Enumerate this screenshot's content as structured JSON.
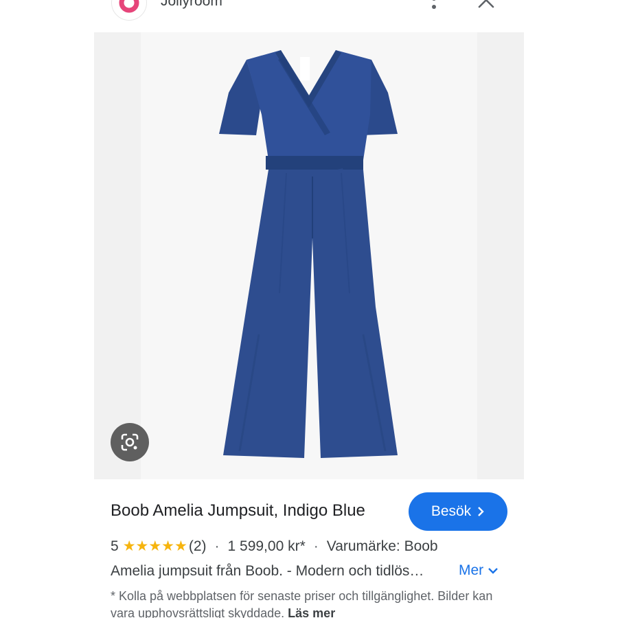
{
  "header": {
    "site_name": "Jollyroom",
    "favicon_icon": "jollyroom-logo-icon",
    "more_icon": "more-vertical-icon",
    "close_icon": "close-icon"
  },
  "image": {
    "subject": "jumpsuit",
    "lens_icon": "google-lens-icon"
  },
  "product": {
    "title": "Boob Amelia Jumpsuit, Indigo Blue",
    "visit_label": "Besök",
    "rating": "5",
    "rating_stars": 5,
    "review_count": "(2)",
    "separator": "·",
    "price": "1 599,00 kr*",
    "brand": "Varumärke: Boob",
    "description": "Amelia jumpsuit från Boob. - Modern och tidlös…",
    "more_label": "Mer",
    "disclaimer": "* Kolla på webbplatsen för senaste priser och tillgänglighet. Bilder kan vara upphovsrättsligt skyddade.",
    "read_more_label": "Läs mer"
  },
  "colors": {
    "accent": "#1a73e8",
    "star": "#f6b40e",
    "jumpsuit": "#2e4d8f",
    "logo": "#e6457a"
  }
}
